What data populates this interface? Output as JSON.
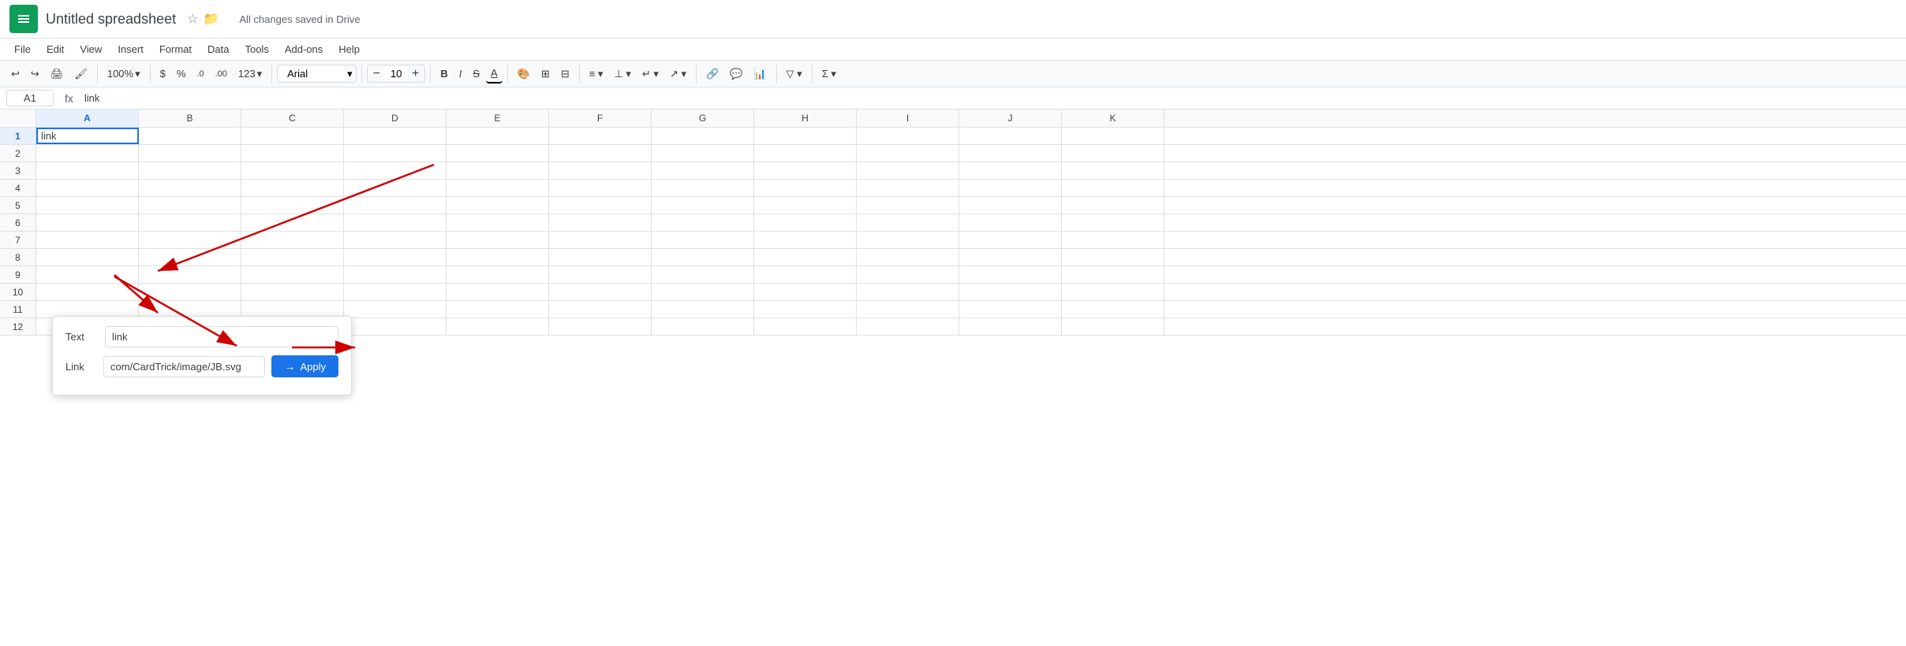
{
  "title": {
    "app_name": "Untitled spreadsheet",
    "save_status": "All changes saved in Drive",
    "star_icon": "★",
    "folder_icon": "📁"
  },
  "menu": {
    "items": [
      "File",
      "Edit",
      "View",
      "Insert",
      "Format",
      "Data",
      "Tools",
      "Add-ons",
      "Help"
    ]
  },
  "toolbar": {
    "undo_label": "↩",
    "redo_label": "↪",
    "print_label": "🖨",
    "format_paint_label": "🖌",
    "zoom_label": "100%",
    "currency_label": "$",
    "percent_label": "%",
    "decimal_dec_label": ".0",
    "decimal_inc_label": ".00",
    "format_num_label": "123",
    "font_name": "Arial",
    "font_size": "10",
    "bold_label": "B",
    "italic_label": "I",
    "strikethrough_label": "S",
    "underline_label": "A",
    "fill_color_label": "A",
    "borders_label": "⊞",
    "merge_label": "⊟",
    "align_h_label": "≡",
    "align_v_label": "⊥",
    "text_wrap_label": "↵",
    "text_rotate_label": "↗",
    "link_label": "🔗",
    "comment_label": "+",
    "chart_label": "📊",
    "filter_label": "▽",
    "functions_label": "Σ"
  },
  "formula_bar": {
    "cell_ref": "A1",
    "fx_label": "fx",
    "formula_value": "link"
  },
  "columns": [
    "A",
    "B",
    "C",
    "D",
    "E",
    "F",
    "G",
    "H",
    "I",
    "J",
    "K"
  ],
  "rows": [
    {
      "id": 1,
      "cells": [
        "link",
        "",
        "",
        "",
        "",
        "",
        "",
        "",
        "",
        "",
        ""
      ]
    },
    {
      "id": 2,
      "cells": [
        "",
        "",
        "",
        "",
        "",
        "",
        "",
        "",
        "",
        "",
        ""
      ]
    },
    {
      "id": 3,
      "cells": [
        "",
        "",
        "",
        "",
        "",
        "",
        "",
        "",
        "",
        "",
        ""
      ]
    },
    {
      "id": 4,
      "cells": [
        "",
        "",
        "",
        "",
        "",
        "",
        "",
        "",
        "",
        "",
        ""
      ]
    },
    {
      "id": 5,
      "cells": [
        "",
        "",
        "",
        "",
        "",
        "",
        "",
        "",
        "",
        "",
        ""
      ]
    },
    {
      "id": 6,
      "cells": [
        "",
        "",
        "",
        "",
        "",
        "",
        "",
        "",
        "",
        "",
        ""
      ]
    },
    {
      "id": 7,
      "cells": [
        "",
        "",
        "",
        "",
        "",
        "",
        "",
        "",
        "",
        "",
        ""
      ]
    },
    {
      "id": 8,
      "cells": [
        "",
        "",
        "",
        "",
        "",
        "",
        "",
        "",
        "",
        "",
        ""
      ]
    },
    {
      "id": 9,
      "cells": [
        "",
        "",
        "",
        "",
        "",
        "",
        "",
        "",
        "",
        "",
        ""
      ]
    },
    {
      "id": 10,
      "cells": [
        "",
        "",
        "",
        "",
        "",
        "",
        "",
        "",
        "",
        "",
        ""
      ]
    },
    {
      "id": 11,
      "cells": [
        "",
        "",
        "",
        "",
        "",
        "",
        "",
        "",
        "",
        "",
        ""
      ]
    },
    {
      "id": 12,
      "cells": [
        "",
        "",
        "",
        "",
        "",
        "",
        "",
        "",
        "",
        "",
        ""
      ]
    }
  ],
  "link_popup": {
    "text_label": "Text",
    "text_value": "link",
    "link_label": "Link",
    "link_value": "com/CardTrick/image/JB.svg",
    "apply_label": "Apply",
    "arrow_icon": "→"
  }
}
